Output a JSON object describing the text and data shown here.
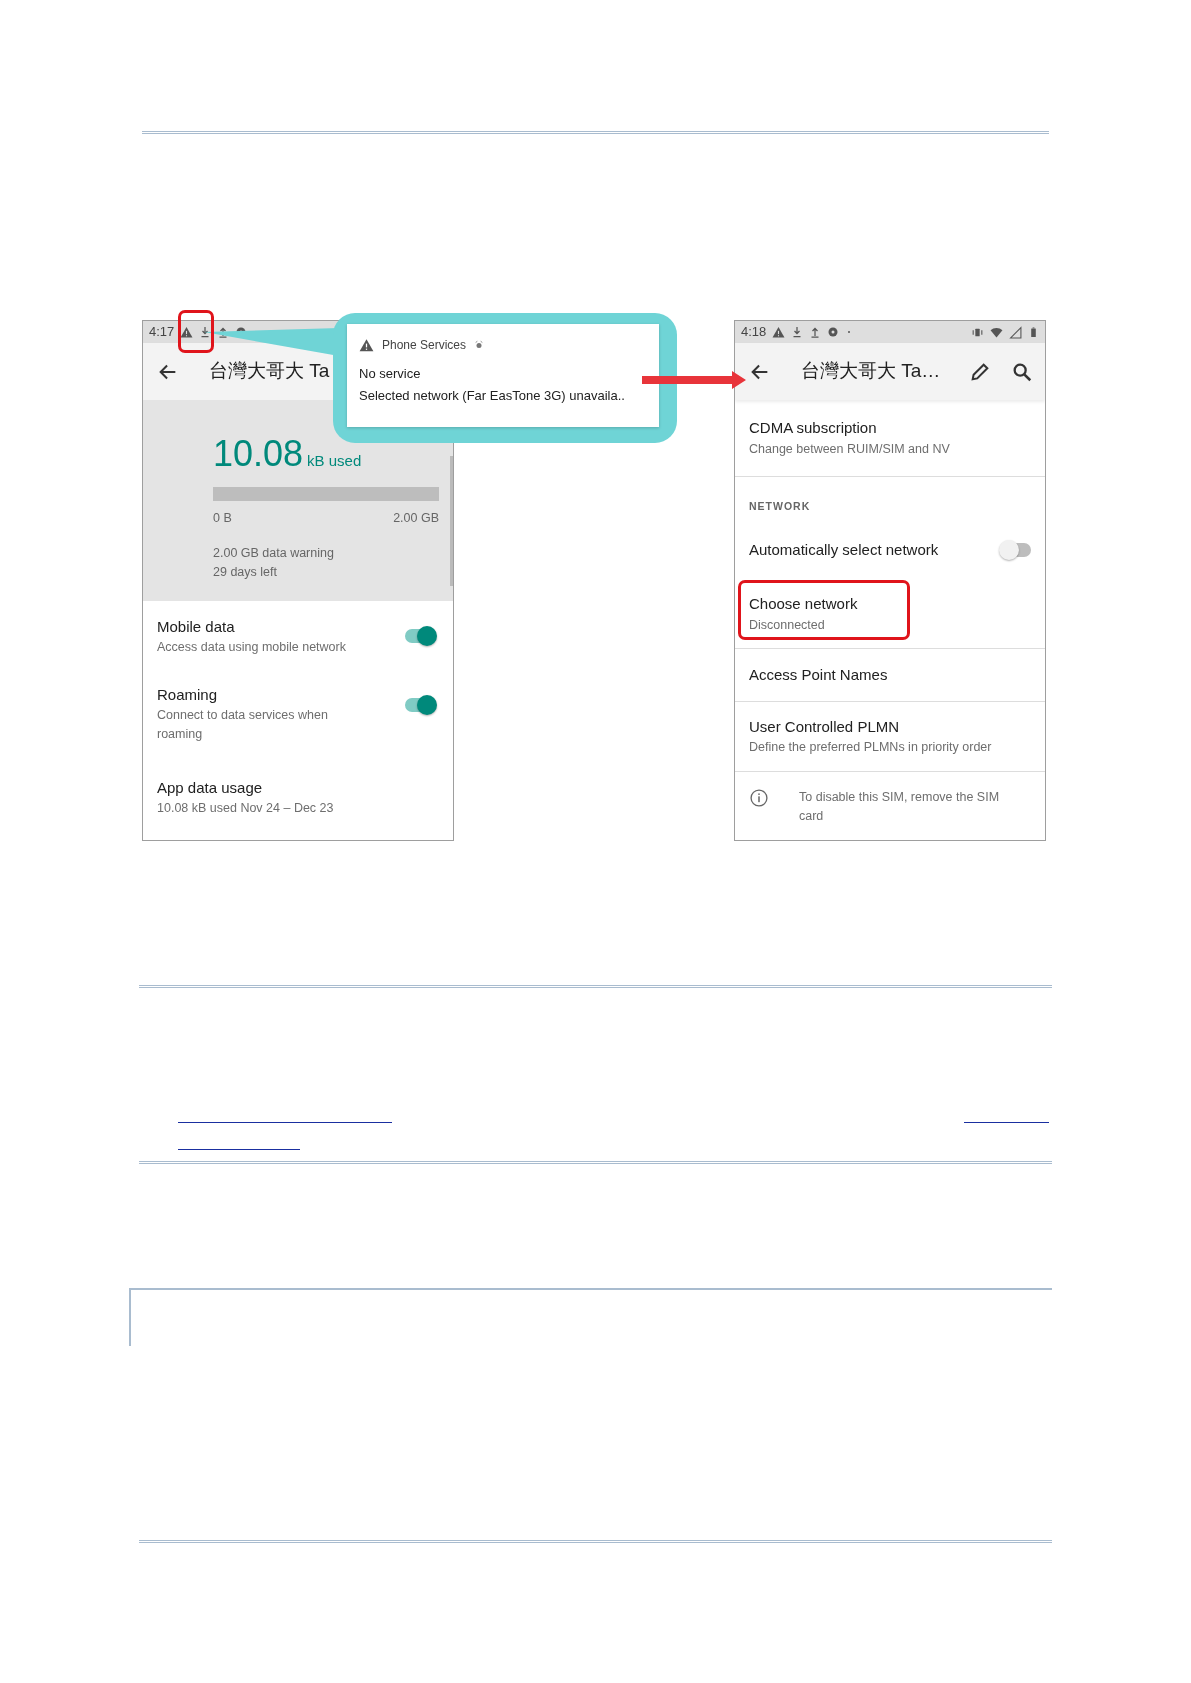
{
  "left_phone": {
    "status_bar": {
      "time": "4:17"
    },
    "app_bar": {
      "title": "台灣大哥大 Ta"
    },
    "usage": {
      "amount": "10.08",
      "unit": "kB used",
      "min": "0 B",
      "max": "2.00 GB",
      "warning": "2.00 GB data warning",
      "days_left": "29 days left"
    },
    "settings": [
      {
        "kind": "switch",
        "title": "Mobile data",
        "summary": "Access data using mobile network",
        "on": true
      },
      {
        "kind": "switch",
        "title": "Roaming",
        "summary": "Connect to data services when roaming",
        "on": true
      },
      {
        "kind": "plain",
        "title": "App data usage",
        "summary": "10.08 kB used Nov 24 – Dec 23"
      }
    ]
  },
  "notification": {
    "app": "Phone Services",
    "title": "No service",
    "text": "Selected network (Far EasTone 3G) unavaila.."
  },
  "right_phone": {
    "status_bar": {
      "time": "4:18"
    },
    "app_bar": {
      "title": "台灣大哥大 Ta…"
    },
    "settings": [
      {
        "kind": "item",
        "title": "CDMA subscription",
        "summary": "Change between RUIM/SIM and NV",
        "highlighted": false
      },
      {
        "kind": "header",
        "title": "NETWORK"
      },
      {
        "kind": "switch",
        "title": "Automatically select network",
        "on": false
      },
      {
        "kind": "item",
        "title": "Choose network",
        "summary": "Disconnected",
        "highlighted": true
      },
      {
        "kind": "item",
        "title": "Access Point Names",
        "highlighted": false
      },
      {
        "kind": "item",
        "title": "User Controlled PLMN",
        "summary": "Define the preferred PLMNs in priority order",
        "highlighted": false
      },
      {
        "kind": "info",
        "title": "To disable this SIM, remove the SIM card"
      }
    ]
  }
}
